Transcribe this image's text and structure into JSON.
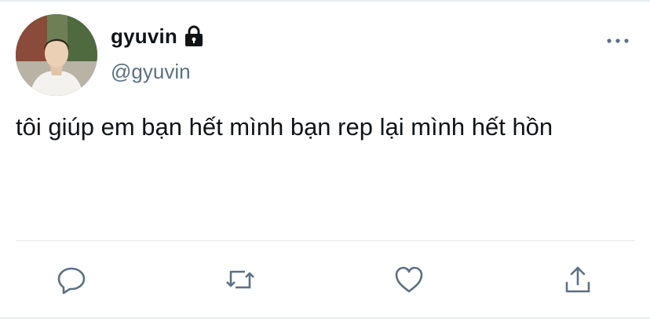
{
  "tweet": {
    "display_name": "gyuvin",
    "handle": "@gyuvin",
    "text": "tôi giúp em bạn hết mình bạn rep lại mình hết hồn",
    "protected_icon": "lock-icon",
    "more_icon": "more-icon",
    "avatar_icon": "avatar"
  },
  "actions": [
    {
      "name": "reply",
      "icon": "reply-icon"
    },
    {
      "name": "retweet",
      "icon": "retweet-icon"
    },
    {
      "name": "like",
      "icon": "like-icon"
    },
    {
      "name": "share",
      "icon": "share-icon"
    }
  ],
  "colors": {
    "text": "#0f1419",
    "secondary": "#5b7083",
    "icon": "#5b7083",
    "divider": "#e1e6ea"
  }
}
